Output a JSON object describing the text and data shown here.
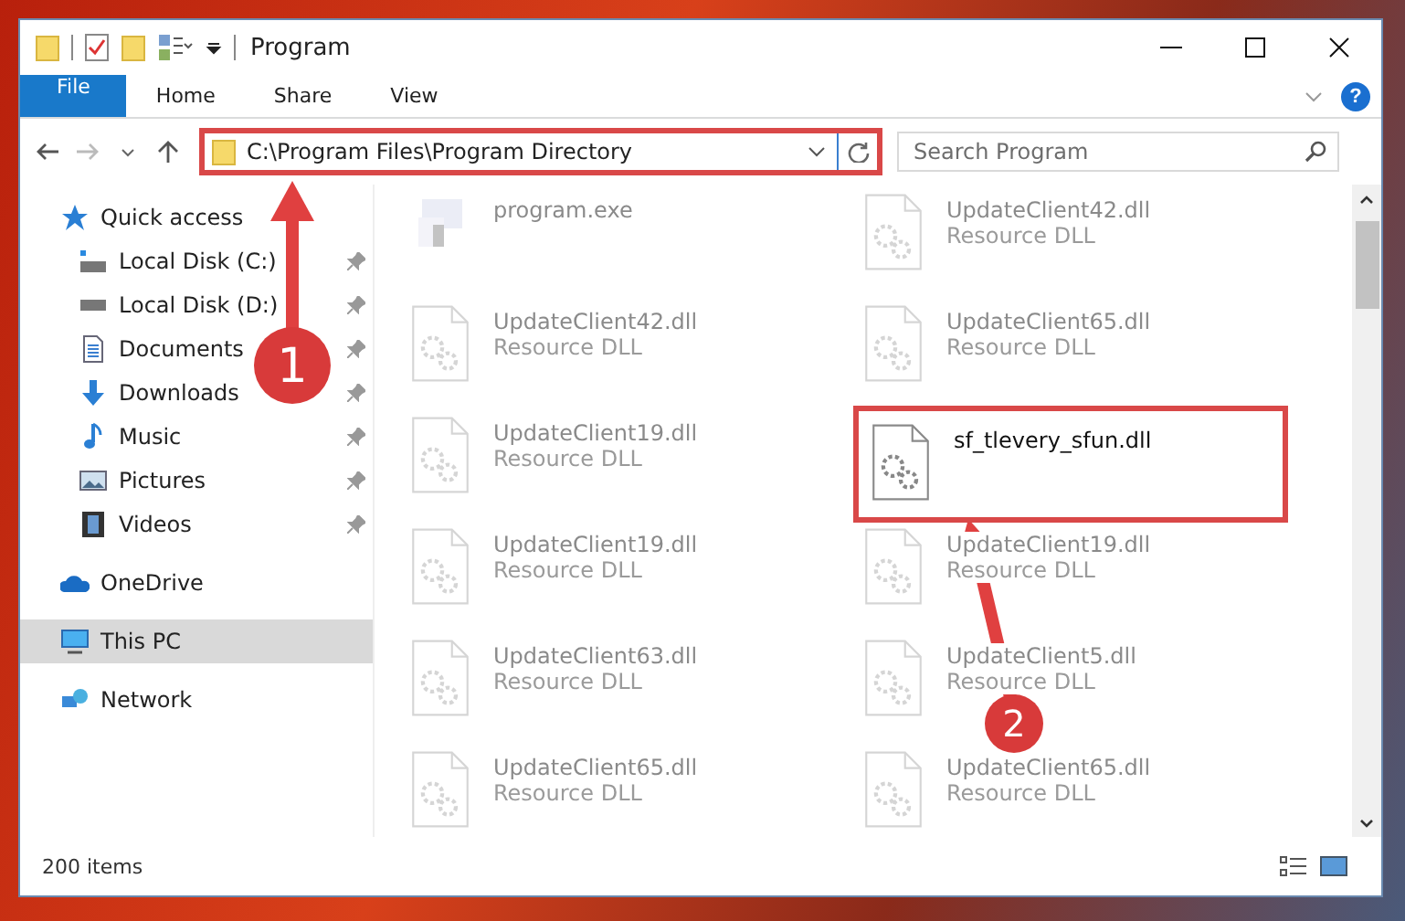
{
  "window": {
    "title": "Program"
  },
  "ribbon": {
    "help_label": "?",
    "tabs": [
      {
        "label": "File",
        "kind": "file"
      },
      {
        "label": "Home",
        "kind": "tab"
      },
      {
        "label": "Share",
        "kind": "tab"
      },
      {
        "label": "View",
        "kind": "tab"
      }
    ]
  },
  "address_bar": {
    "path": "C:\\Program Files\\Program Directory",
    "highlighted": true
  },
  "search": {
    "placeholder": "Search Program"
  },
  "sidebar": {
    "items": [
      {
        "label": "Quick access",
        "kind": "star",
        "selected": false,
        "children": [
          {
            "label": "Local Disk (C:)",
            "kind": "disk-c",
            "pinned": true,
            "selected": false
          },
          {
            "label": "Local Disk (D:)",
            "kind": "disk",
            "pinned": true,
            "selected": false
          },
          {
            "label": "Documents",
            "kind": "documents",
            "pinned": true,
            "selected": false
          },
          {
            "label": "Downloads",
            "kind": "downloads",
            "pinned": true,
            "selected": false
          },
          {
            "label": "Music",
            "kind": "music",
            "pinned": true,
            "selected": false
          },
          {
            "label": "Pictures",
            "kind": "pictures",
            "pinned": true,
            "selected": false
          },
          {
            "label": "Videos",
            "kind": "videos",
            "pinned": true,
            "selected": false
          }
        ]
      },
      {
        "label": "OneDrive",
        "kind": "cloud",
        "selected": false
      },
      {
        "label": "This PC",
        "kind": "pc",
        "selected": true
      },
      {
        "label": "Network",
        "kind": "network",
        "selected": false
      }
    ]
  },
  "files": [
    {
      "name": "program.exe",
      "kind": "exe",
      "blurred": true,
      "highlighted": false
    },
    {
      "name": "UpdateClient42.dll",
      "type": "Resource DLL",
      "kind": "dll",
      "blurred": true,
      "highlighted": false
    },
    {
      "name": "UpdateClient42.dll",
      "type": "Resource DLL",
      "kind": "dll",
      "blurred": true,
      "highlighted": false
    },
    {
      "name": "UpdateClient65.dll",
      "type": "Resource DLL",
      "kind": "dll",
      "blurred": true,
      "highlighted": false
    },
    {
      "name": "UpdateClient19.dll",
      "type": "Resource DLL",
      "kind": "dll",
      "blurred": true,
      "highlighted": false
    },
    {
      "name": "sf_tlevery_sfun.dll",
      "kind": "dll",
      "blurred": false,
      "highlighted": true
    },
    {
      "name": "UpdateClient19.dll",
      "type": "Resource DLL",
      "kind": "dll",
      "blurred": true,
      "highlighted": false
    },
    {
      "name": "UpdateClient19.dll",
      "type": "Resource DLL",
      "kind": "dll",
      "blurred": true,
      "highlighted": false
    },
    {
      "name": "UpdateClient63.dll",
      "type": "Resource DLL",
      "kind": "dll",
      "blurred": true,
      "highlighted": false
    },
    {
      "name": "UpdateClient5.dll",
      "type": "Resource DLL",
      "kind": "dll",
      "blurred": true,
      "highlighted": false
    },
    {
      "name": "UpdateClient65.dll",
      "type": "Resource DLL",
      "kind": "dll",
      "blurred": true,
      "highlighted": false
    },
    {
      "name": "UpdateClient65.dll",
      "type": "Resource DLL",
      "kind": "dll",
      "blurred": true,
      "highlighted": false
    }
  ],
  "status_bar": {
    "item_count": "200 items"
  },
  "annotations": [
    {
      "label": "1"
    },
    {
      "label": "2"
    }
  ]
}
